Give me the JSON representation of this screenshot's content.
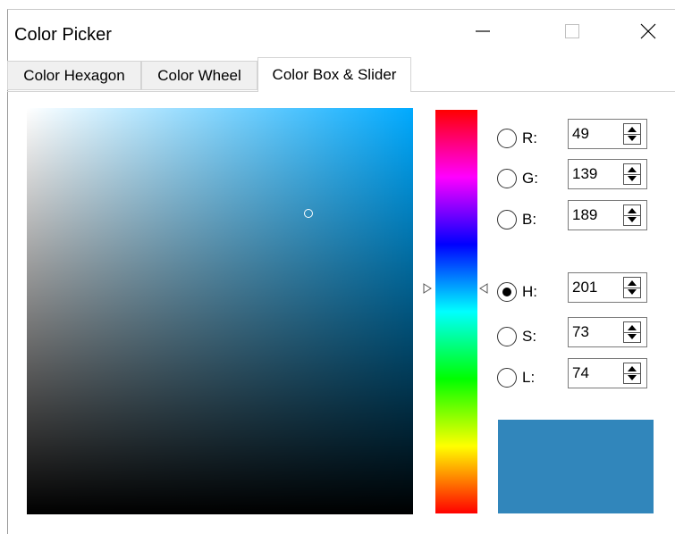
{
  "window": {
    "title": "Color Picker",
    "minimize_glyph": "—",
    "maximize_glyph": "☐",
    "close_glyph": "✕"
  },
  "tabs": [
    {
      "label": "Color Hexagon",
      "active": false
    },
    {
      "label": "Color Wheel",
      "active": false
    },
    {
      "label": "Color Box & Slider",
      "active": true
    }
  ],
  "color_box": {
    "hue_color": "#00aaff"
  },
  "hue_slider": {
    "value": 201
  },
  "channels": [
    {
      "key": "r",
      "label": "R:",
      "value": "49",
      "checked": false
    },
    {
      "key": "g",
      "label": "G:",
      "value": "139",
      "checked": false
    },
    {
      "key": "b",
      "label": "B:",
      "value": "189",
      "checked": false
    },
    {
      "key": "h",
      "label": "H:",
      "value": "201",
      "checked": true
    },
    {
      "key": "s",
      "label": "S:",
      "value": "73",
      "checked": false
    },
    {
      "key": "l",
      "label": "L:",
      "value": "74",
      "checked": false
    }
  ],
  "preview": {
    "color": "#3186bb"
  }
}
